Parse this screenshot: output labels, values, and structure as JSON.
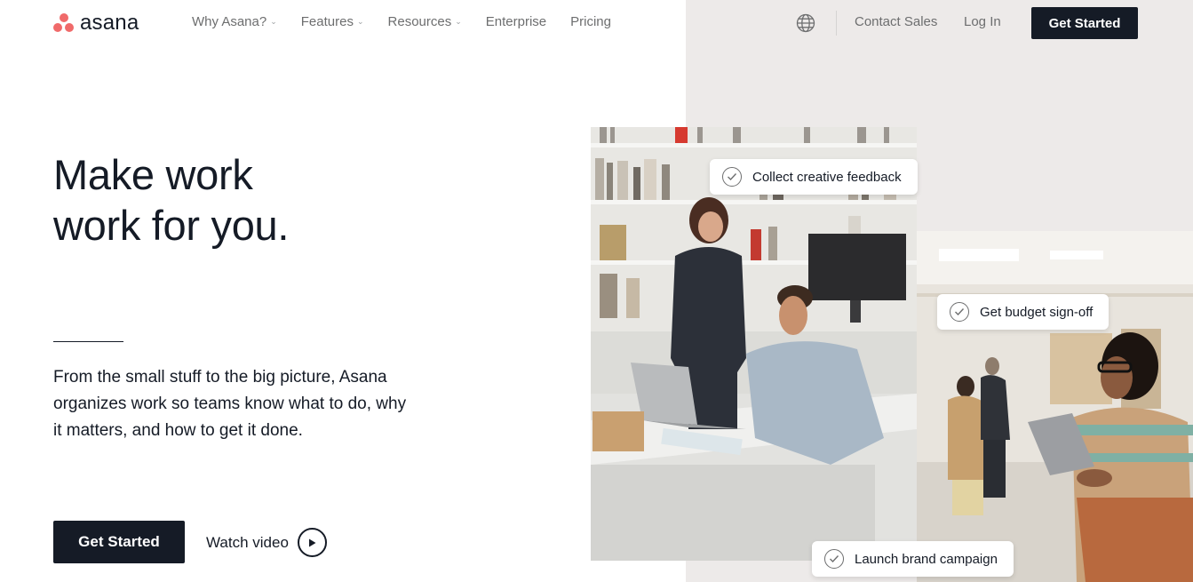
{
  "brand": {
    "name": "asana",
    "accent": "#f06a6a",
    "dark": "#151b26",
    "panel_bg": "#edeae9"
  },
  "nav": {
    "items": [
      {
        "label": "Why Asana?",
        "dropdown": true
      },
      {
        "label": "Features",
        "dropdown": true
      },
      {
        "label": "Resources",
        "dropdown": true
      },
      {
        "label": "Enterprise",
        "dropdown": false
      },
      {
        "label": "Pricing",
        "dropdown": false
      }
    ],
    "globe_icon": "globe-icon",
    "contact": "Contact Sales",
    "login": "Log In",
    "cta": "Get Started"
  },
  "hero": {
    "headline_line1": "Make work",
    "headline_line2": "work for you.",
    "subtext": "From the small stuff to the big picture, Asana organizes work so teams know what to do, why it matters, and how to get it done.",
    "cta": "Get Started",
    "watch_video": "Watch video"
  },
  "chips": [
    "Collect creative feedback",
    "Get budget sign-off",
    "Launch brand campaign"
  ]
}
